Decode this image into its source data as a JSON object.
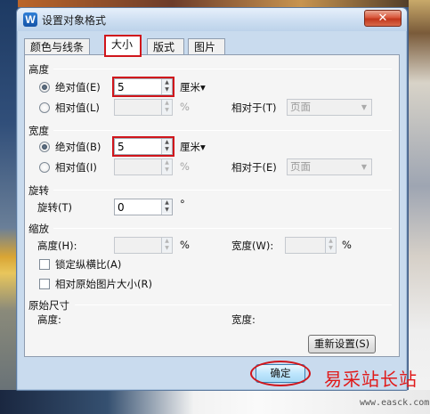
{
  "window": {
    "title": "设置对象格式",
    "app_icon": "W",
    "close_glyph": "✕"
  },
  "tabs": [
    {
      "label": "颜色与线条",
      "active": false
    },
    {
      "label": "大小",
      "active": true
    },
    {
      "label": "版式",
      "active": false
    },
    {
      "label": "图片",
      "active": false
    }
  ],
  "height": {
    "group": "高度",
    "absolute_label": "绝对值(E)",
    "absolute_value": "5",
    "unit": "厘米▾",
    "relative_label": "相对值(L)",
    "relative_unit": "%",
    "relative_to_label": "相对于(T)",
    "relative_to_value": "页面"
  },
  "width": {
    "group": "宽度",
    "absolute_label": "绝对值(B)",
    "absolute_value": "5",
    "unit": "厘米▾",
    "relative_label": "相对值(I)",
    "relative_unit": "%",
    "relative_to_label": "相对于(E)",
    "relative_to_value": "页面"
  },
  "rotate": {
    "group": "旋转",
    "label": "旋转(T)",
    "value": "0",
    "unit": "°"
  },
  "scale": {
    "group": "缩放",
    "height_label": "高度(H):",
    "height_unit": "%",
    "width_label": "宽度(W):",
    "width_unit": "%",
    "lock_label": "锁定纵横比(A)",
    "relative_original_label": "相对原始图片大小(R)"
  },
  "original": {
    "group": "原始尺寸",
    "height_label": "高度:",
    "width_label": "宽度:",
    "reset_label": "重新设置(S)"
  },
  "footer": {
    "ok_label": "确定"
  },
  "watermark": {
    "text": "易采站长站",
    "site": "www.easck.com"
  },
  "colors": {
    "highlight": "#d0151b",
    "title_bar": "#cfe0f2",
    "close": "#c2371c",
    "ok_button": "#bee6fd"
  }
}
